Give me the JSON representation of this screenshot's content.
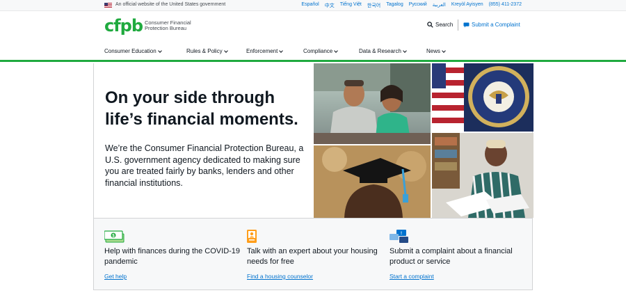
{
  "banner": {
    "official_text": "An official website of the United States government",
    "languages": [
      "Español",
      "中文",
      "Tiếng Việt",
      "한국어",
      "Tagalog",
      "Русский",
      "العربية",
      "Kreyòl Ayisyen"
    ],
    "phone": "(855) 411-2372"
  },
  "header": {
    "logo_mark": "cfpb",
    "logo_text": "Consumer Financial Protection Bureau",
    "search_label": "Search",
    "complaint_label": "Submit a Complaint"
  },
  "nav": {
    "items": [
      "Consumer Education",
      "Rules & Policy",
      "Enforcement",
      "Compliance",
      "Data & Research",
      "News"
    ]
  },
  "hero": {
    "title_strong": "On your side",
    "title_rest": " through life’s financial moments.",
    "body": "We’re the Consumer Financial Protection Bureau, a U.S. government agency dedicated to making sure you are treated fairly by banks, lenders and other financial institutions."
  },
  "cards": [
    {
      "text": "Help with finances during the COVID-19 pandemic",
      "link": "Get help",
      "icon": "money-icon"
    },
    {
      "text": "Talk with an expert about your housing needs for free",
      "link": "Find a housing counselor",
      "icon": "counselor-icon"
    },
    {
      "text": "Submit a complaint about a financial product or service",
      "link": "Start a complaint",
      "icon": "complaint-chat-icon"
    }
  ],
  "colors": {
    "brand_green": "#20aa3f",
    "link_blue": "#0072ce",
    "text": "#101820"
  }
}
